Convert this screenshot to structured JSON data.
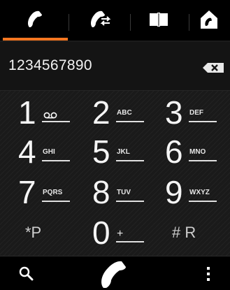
{
  "tabs": [
    {
      "id": "dialer",
      "icon": "phone-handset-icon",
      "active": true
    },
    {
      "id": "call-log",
      "icon": "phone-transfer-icon",
      "active": false
    },
    {
      "id": "contacts",
      "icon": "phonebook-icon",
      "active": false
    },
    {
      "id": "home",
      "icon": "home-phone-icon",
      "active": false
    }
  ],
  "accent_color": "#f47621",
  "display": {
    "number": "1234567890",
    "backspace_icon": "backspace-icon"
  },
  "keypad": {
    "keys": [
      {
        "digit": "1",
        "letters": "oo"
      },
      {
        "digit": "2",
        "letters": "ABC"
      },
      {
        "digit": "3",
        "letters": "DEF"
      },
      {
        "digit": "4",
        "letters": "GHI"
      },
      {
        "digit": "5",
        "letters": "JKL"
      },
      {
        "digit": "6",
        "letters": "MNO"
      },
      {
        "digit": "7",
        "letters": "PQRS"
      },
      {
        "digit": "8",
        "letters": "TUV"
      },
      {
        "digit": "9",
        "letters": "WXYZ"
      },
      {
        "digit": "",
        "letters": "",
        "symbol": "*P"
      },
      {
        "digit": "0",
        "letters": "+"
      },
      {
        "digit": "",
        "letters": "",
        "symbol": "# R"
      }
    ]
  },
  "bottombar": {
    "search_icon": "search-icon",
    "call_icon": "call-icon",
    "more_icon": "more-vert-icon"
  }
}
